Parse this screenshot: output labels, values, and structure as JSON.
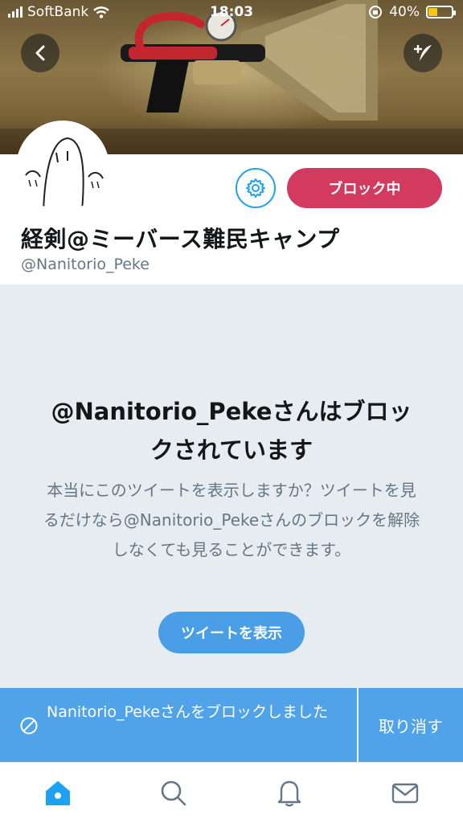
{
  "status_bar": {
    "carrier": "SoftBank",
    "time": "18:03",
    "battery_percent": "40%",
    "battery_level": 0.4
  },
  "header": {
    "back_icon": "chevron-left-icon",
    "compose_icon": "compose-tweet-icon"
  },
  "profile": {
    "name": "経剣@ミーバース難民キャンプ",
    "handle": "@Nanitorio_Peke",
    "settings_icon": "gear-icon",
    "block_button_label": "ブロック中",
    "block_button_color": "#d23a5f"
  },
  "blocked_notice": {
    "title": "@Nanitorio_Pekeさんはブロックされています",
    "description": "本当にこのツイートを表示しますか？ツイートを見るだけなら@Nanitorio_Pekeさんのブロックを解除しなくても見ることができます。",
    "view_button_label": "ツイートを表示"
  },
  "toast": {
    "icon": "blocked-icon",
    "message": "Nanitorio_Pekeさんをブロックしました",
    "undo_label": "取り消す"
  },
  "tab_bar": {
    "items": [
      {
        "icon": "home-icon",
        "active": true
      },
      {
        "icon": "search-icon",
        "active": false
      },
      {
        "icon": "bell-icon",
        "active": false
      },
      {
        "icon": "mail-icon",
        "active": false
      }
    ]
  },
  "colors": {
    "accent": "#1da1f2",
    "block": "#d23a5f",
    "toast": "#50a3e8"
  }
}
